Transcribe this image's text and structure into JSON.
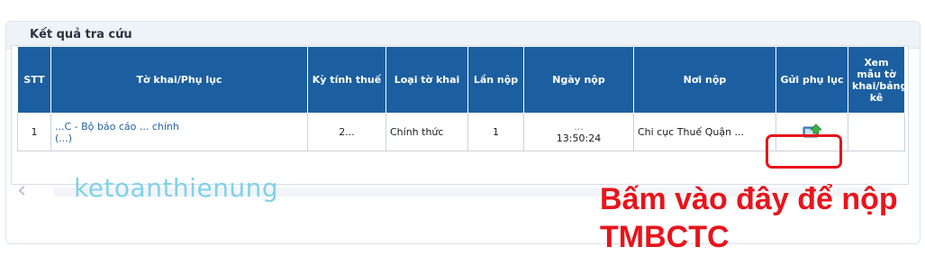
{
  "panel": {
    "title": "Kết quả tra cứu"
  },
  "table": {
    "headers": [
      {
        "label": "STT"
      },
      {
        "label": "Tờ khai/Phụ lục"
      },
      {
        "label": "Kỳ tính thuế"
      },
      {
        "label": "Loại tờ khai"
      },
      {
        "label": "Lần nộp"
      },
      {
        "label": "Ngày nộp"
      },
      {
        "label": "Nơi nộp"
      },
      {
        "label": "Gửi phụ lục"
      },
      {
        "label": "Xem mẫu tờ khai/bảng kê"
      }
    ],
    "rows": [
      {
        "stt": "1",
        "to_khai": "...C - Bộ báo cáo ... chính",
        "to_khai_sub": "(...)",
        "ky_tinh_thue": "2...",
        "loai_to_khai": "Chính thức",
        "lan_nop": "1",
        "ngay_nop_date": "...",
        "ngay_nop_time": "13:50:24",
        "noi_nop": "Chi cục Thuế Quận ...",
        "gui_phu_luc_icon": "upload-icon"
      }
    ]
  },
  "watermark": "ketoanthienung",
  "annotation": {
    "line1": "Bấm vào đây để nộp",
    "line2": "TMBCTC"
  },
  "colors": {
    "header_bg": "#1c5fa0",
    "annotation": "#e8141b",
    "watermark": "#7fd2ea",
    "link": "#1f5fa8"
  }
}
